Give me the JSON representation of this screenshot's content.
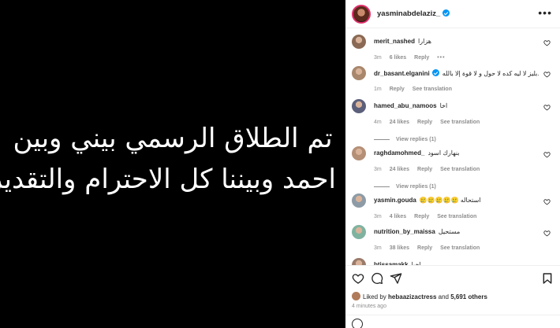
{
  "post": {
    "media_lines": [
      "تم الطلاق الرسمي بيني وبين",
      "احمد وبيننا كل الاحترام والتقدير"
    ]
  },
  "header": {
    "username": "yasminabdelaziz_",
    "more_label": "•••"
  },
  "comments": [
    {
      "user": "merit_nashed",
      "text": "هزارا",
      "time": "3m",
      "likes": "6 likes",
      "reply": "Reply",
      "extra": "•••",
      "avatar_color": "#8a6a55"
    },
    {
      "user": "dr_basant.elganini",
      "verified": true,
      "text": "لا ...بليز لا ليه كده لا حول و لا قوة إلا بالله",
      "time": "1m",
      "likes": "",
      "reply": "Reply",
      "extra": "See translation",
      "avatar_color": "#a8876c"
    },
    {
      "user": "hamed_abu_namoos",
      "text": "اخا",
      "time": "4m",
      "likes": "24 likes",
      "reply": "Reply",
      "extra": "See translation",
      "avatar_color": "#5b5f7a",
      "view_replies": "View replies (1)"
    },
    {
      "user": "raghdamohmed_",
      "text": "بنهارك اسود",
      "time": "3m",
      "likes": "24 likes",
      "reply": "Reply",
      "extra": "See translation",
      "avatar_color": "#b58f76",
      "view_replies": "View replies (1)"
    },
    {
      "user": "yasmin.gouda",
      "text": "استحاله 🥲🥲🥲🥲🥲",
      "time": "3m",
      "likes": "4 likes",
      "reply": "Reply",
      "extra": "See translation",
      "avatar_color": "#8d9ba6"
    },
    {
      "user": "nutrition_by_maissa",
      "text": "مستحيل",
      "time": "3m",
      "likes": "38 likes",
      "reply": "Reply",
      "extra": "See translation",
      "avatar_color": "#7fb3a0"
    },
    {
      "user": "btissamakk",
      "text": "اخيا",
      "time": "",
      "likes": "",
      "reply": "",
      "extra": "",
      "avatar_color": "#9a7b6a"
    }
  ],
  "footer": {
    "liked_by_prefix": "Liked by ",
    "liked_by_user": "hebaazizactress",
    "liked_by_mid": " and ",
    "liked_by_count": "5,691 others",
    "time_ago": "4 minutes ago"
  },
  "colors": {
    "verified": "#0095f6",
    "story_ring": "#e1306c"
  }
}
